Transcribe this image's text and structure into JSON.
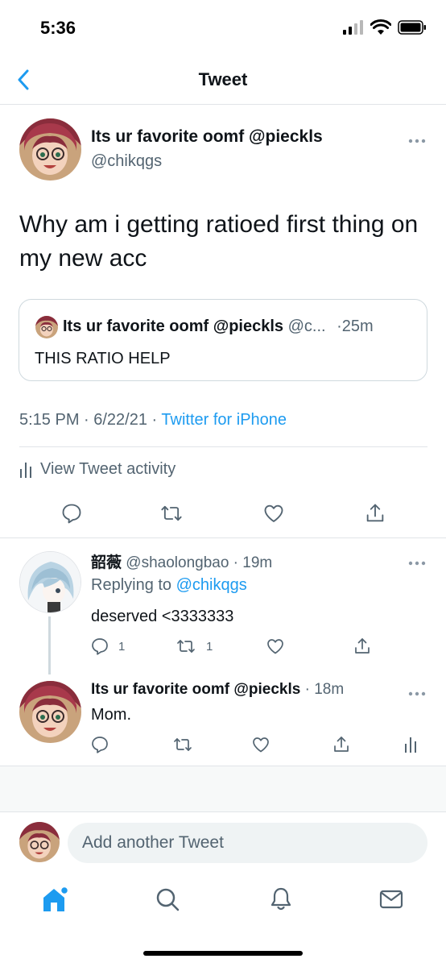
{
  "status_bar": {
    "time": "5:36"
  },
  "nav": {
    "title": "Tweet"
  },
  "main_tweet": {
    "display_name": "Its ur favorite oomf @pieckls",
    "handle": "@chikqgs",
    "text": "Why am i getting ratioed first thing on my new acc",
    "quoted": {
      "display_name": "Its ur favorite oomf @pieckls",
      "handle_truncated": "@c...",
      "time": "·25m",
      "text": "THIS RATIO HELP"
    },
    "timestamp": "5:15 PM · 6/22/21 · ",
    "client": "Twitter for iPhone",
    "activity_label": "View Tweet activity"
  },
  "replies": [
    {
      "display_name": "韶薇",
      "handle_time": " @shaolongbao · 19m",
      "replying_prefix": "Replying to ",
      "replying_to": "@chikqgs",
      "text": "deserved <3333333",
      "reply_count": "1",
      "retweet_count": "1"
    },
    {
      "display_name": "Its ur favorite oomf @pieckls",
      "time": " · 18m",
      "text": "Mom."
    }
  ],
  "compose": {
    "placeholder": "Add another Tweet"
  },
  "tabs": [
    "home-icon",
    "search-icon",
    "notifications-icon",
    "messages-icon"
  ],
  "colors": {
    "accent": "#1d9bf0",
    "muted": "#536471",
    "border": "#cfd9de"
  }
}
